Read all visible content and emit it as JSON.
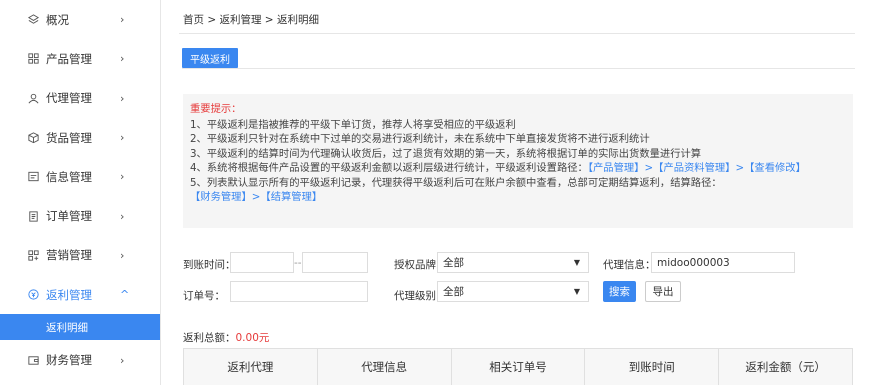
{
  "sidebar": {
    "items": [
      {
        "label": "概况"
      },
      {
        "label": "产品管理"
      },
      {
        "label": "代理管理"
      },
      {
        "label": "货品管理"
      },
      {
        "label": "信息管理"
      },
      {
        "label": "订单管理"
      },
      {
        "label": "营销管理"
      },
      {
        "label": "返利管理"
      },
      {
        "label": "财务管理"
      }
    ],
    "chevron": "›",
    "chevron_up": "^",
    "sub_item": "返利明细",
    "accent": "#3a87f0"
  },
  "breadcrumb": "首页 > 返利管理 > 返利明细",
  "tab": "平级返利",
  "notice": {
    "title": "重要提示：",
    "lines": {
      "l1": "1、平级返利是指被推荐的平级下单订货，推荐人将享受相应的平级返利",
      "l2": "2、平级返利只针对在系统中下过单的交易进行返利统计，未在系统中下单直接发货将不进行返利统计",
      "l3": "3、平级返利的结算时间为代理确认收货后，过了退货有效期的第一天，系统将根据订单的实际出货数量进行计算",
      "l4_prefix": "4、系统将根据每件产品设置的平级返利金额以返利层级进行统计，平级返利设置路径：",
      "l4_link": "【产品管理】>【产品资料管理】>【查看修改】",
      "l5_prefix": "5、列表默认显示所有的平级返利记录，代理获得平级返利后可在账户余额中查看，总部可定期结算返利，结算路径：",
      "l5_link": "【财务管理】>【结算管理】"
    }
  },
  "filters": {
    "time_label": "到账时间：",
    "time_sep": "--",
    "brand_label": "授权品牌：",
    "brand_value": "全部",
    "info_label": "代理信息：",
    "info_value": "midoo000003",
    "order_label": "订单号：",
    "level_label": "代理级别：",
    "level_value": "全部",
    "search_btn": "搜索",
    "export_btn": "导出"
  },
  "summary": {
    "label": "返利总额：",
    "amount": "0.00元"
  },
  "table": {
    "headers": [
      "返利代理",
      "代理信息",
      "相关订单号",
      "到账时间",
      "返利金额（元）"
    ]
  },
  "colors": {
    "primary": "#3a87f0",
    "warning": "#e63b3b"
  }
}
